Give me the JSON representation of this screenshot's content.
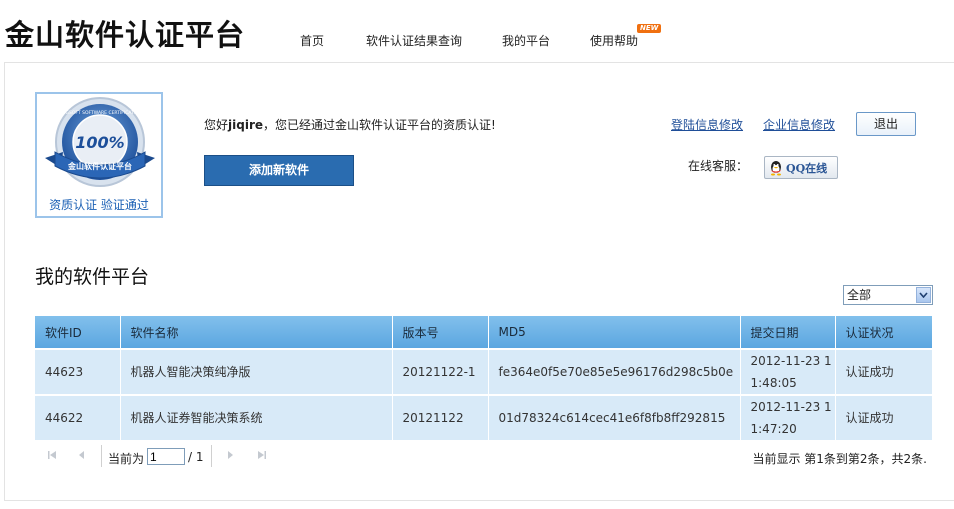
{
  "header": {
    "site_title": "金山软件认证平台",
    "nav": [
      "首页",
      "软件认证结果查询",
      "我的平台",
      "使用帮助"
    ],
    "new_badge": "NEW"
  },
  "profile": {
    "badge_percent": "100%",
    "badge_ring_text": "KINGSOFT SOFTWARE CERTIFICATION",
    "badge_ribbon": "金山软件认证平台",
    "badge_caption": "资质认证 验证通过",
    "greeting_prefix": "您好",
    "username": "jiqire",
    "greeting_suffix": "，您已经通过金山软件认证平台的资质认证!",
    "add_button": "添加新软件",
    "link_login_edit": "登陆信息修改",
    "link_company_edit": "企业信息修改",
    "logout_button": "退出",
    "customer_service_label": "在线客服：",
    "qq_button": "QQ在线"
  },
  "platform": {
    "section_title": "我的软件平台",
    "filter_selected": "全部",
    "columns": [
      "软件ID",
      "软件名称",
      "版本号",
      "MD5",
      "提交日期",
      "认证状况"
    ],
    "rows": [
      {
        "id": "44623",
        "name": "机器人智能决策纯净版",
        "version": "20121122-1",
        "md5": "fe364e0f5e70e85e5e96176d298c5b0e",
        "date_line1": "2012-11-23 1",
        "date_line2": "1:48:05",
        "status": "认证成功"
      },
      {
        "id": "44622",
        "name": "机器人证券智能决策系统",
        "version": "20121122",
        "md5": "01d78324c614cec41e6f8fb8ff292815",
        "date_line1": "2012-11-23 1",
        "date_line2": "1:47:20",
        "status": "认证成功"
      }
    ]
  },
  "pager": {
    "current_label": "当前为",
    "current_page": "1",
    "total_label": "/ 1",
    "summary": "当前显示 第1条到第2条，共2条."
  },
  "colors": {
    "accent_blue": "#2a6cb0",
    "table_header": "#5ba6e0",
    "table_row": "#d8eaf8",
    "link": "#1f4e98"
  }
}
